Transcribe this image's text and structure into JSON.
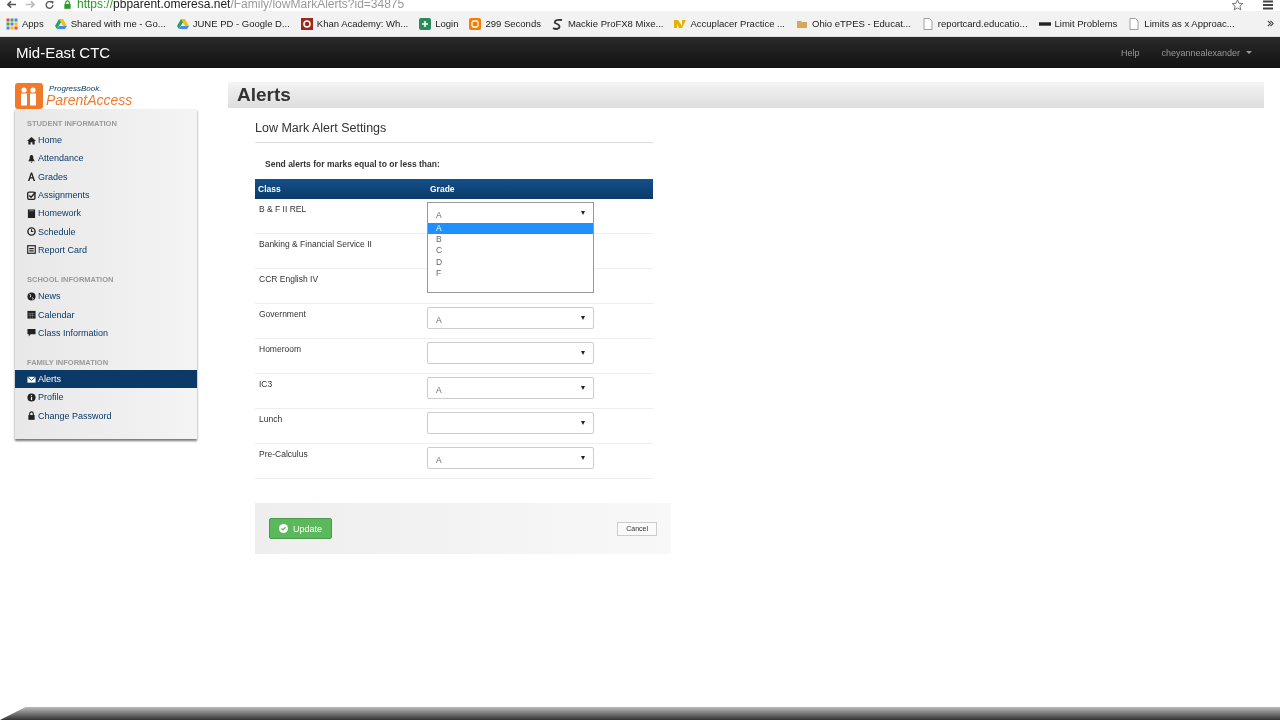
{
  "browser": {
    "url_scheme": "https://",
    "url_host": "pbparent.omeresa.net",
    "url_path": "/Family/lowMarkAlerts?id=34875",
    "bookmarks": [
      {
        "label": "Apps",
        "kind": "grid"
      },
      {
        "label": "Shared with me - Go...",
        "kind": "drive"
      },
      {
        "label": "JUNE PD - Google D...",
        "kind": "drive"
      },
      {
        "label": "Khan Academy: Wh...",
        "kind": "quiz"
      },
      {
        "label": "Login",
        "kind": "plus"
      },
      {
        "label": "299 Seconds",
        "kind": "blog"
      },
      {
        "label": "Mackie ProFX8 Mixe...",
        "kind": "swirl"
      },
      {
        "label": "Accuplacer Practice ...",
        "kind": "mark"
      },
      {
        "label": "Ohio eTPES - Educat...",
        "kind": "folder"
      },
      {
        "label": "reportcard.educatio...",
        "kind": "page"
      },
      {
        "label": "Limit Problems",
        "kind": "bar"
      },
      {
        "label": "Limits as x Approac...",
        "kind": "page"
      }
    ]
  },
  "navbar": {
    "brand": "Mid-East CTC",
    "help": "Help",
    "user": "cheyannealexander"
  },
  "logo": {
    "small": "ProgressBook.",
    "large": "ParentAccess"
  },
  "sidebar": [
    {
      "heading": "STUDENT INFORMATION",
      "items": [
        {
          "label": "Home",
          "kind": "home",
          "selected": false
        },
        {
          "label": "Attendance",
          "kind": "bell",
          "selected": false
        },
        {
          "label": "Grades",
          "kind": "font",
          "selected": false
        },
        {
          "label": "Assignments",
          "kind": "check",
          "selected": false
        },
        {
          "label": "Homework",
          "kind": "book",
          "selected": false
        },
        {
          "label": "Schedule",
          "kind": "clock",
          "selected": false
        },
        {
          "label": "Report Card",
          "kind": "list",
          "selected": false
        }
      ]
    },
    {
      "heading": "SCHOOL INFORMATION",
      "items": [
        {
          "label": "News",
          "kind": "globe",
          "selected": false
        },
        {
          "label": "Calendar",
          "kind": "calendar",
          "selected": false
        },
        {
          "label": "Class Information",
          "kind": "comment",
          "selected": false
        }
      ]
    },
    {
      "heading": "FAMILY INFORMATION",
      "items": [
        {
          "label": "Alerts",
          "kind": "envelope",
          "selected": true
        },
        {
          "label": "Profile",
          "kind": "info",
          "selected": false
        },
        {
          "label": "Change Password",
          "kind": "lock",
          "selected": false
        }
      ]
    }
  ],
  "page_title": "Alerts",
  "section_title": "Low Mark Alert Settings",
  "instructions": "Send alerts for marks equal to or less than:",
  "table": {
    "columns": [
      "Class",
      "Grade"
    ],
    "rows": [
      {
        "class": "B & F II REL",
        "kind": "select",
        "value": "A",
        "expanded": true,
        "options": [
          {
            "label": "A",
            "selected": true
          },
          {
            "label": "B",
            "selected": false
          },
          {
            "label": "C",
            "selected": false
          },
          {
            "label": "D",
            "selected": false
          },
          {
            "label": "F",
            "selected": false
          }
        ]
      },
      {
        "class": "Banking & Financial Service II",
        "kind": "covered"
      },
      {
        "class": "CCR English IV",
        "kind": "covered"
      },
      {
        "class": "Government",
        "kind": "select",
        "value": "A",
        "expanded": false
      },
      {
        "class": "Homeroom",
        "kind": "select",
        "expanded": false
      },
      {
        "class": "IC3",
        "kind": "select",
        "value": "A",
        "expanded": false
      },
      {
        "class": "Lunch",
        "kind": "select",
        "expanded": false
      },
      {
        "class": "Pre-Calculus",
        "kind": "select",
        "value": "A",
        "expanded": false
      }
    ]
  },
  "buttons": {
    "update": "Update",
    "cancel": "Cancel"
  }
}
